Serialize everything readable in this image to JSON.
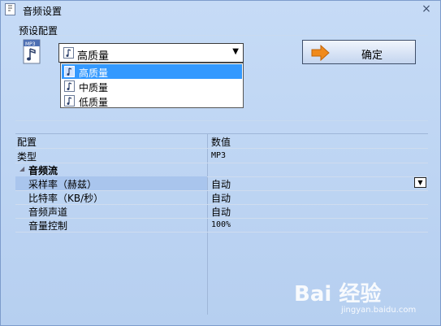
{
  "window": {
    "title": "音频设置",
    "close_glyph": "×"
  },
  "preset": {
    "label": "预设配置",
    "selected": "高质量",
    "options": [
      "高质量",
      "中质量",
      "低质量"
    ]
  },
  "ok_button": {
    "label": "确定"
  },
  "grid": {
    "header": {
      "key": "配置",
      "value": "数值"
    },
    "rows": [
      {
        "key": "类型",
        "value": "MP3"
      },
      {
        "key": "音频流",
        "value": ""
      },
      {
        "key": "采样率（赫兹）",
        "value": "自动"
      },
      {
        "key": "比特率（KB/秒）",
        "value": "自动"
      },
      {
        "key": "音频声道",
        "value": "自动"
      },
      {
        "key": "音量控制",
        "value": "100%"
      }
    ]
  },
  "watermark": {
    "main": "Bai 经验",
    "sub": "jingyan.baidu.com"
  },
  "icons": [
    "app-icon",
    "close-icon",
    "mp3-file-icon",
    "music-note-icon",
    "chevron-down-icon",
    "arrow-right-icon",
    "expander-icon"
  ],
  "colors": {
    "background": "#bcd4f4",
    "selection": "#3399ff",
    "row_highlight": "#a9c5ed",
    "accent_arrow": "#f08a1c"
  }
}
